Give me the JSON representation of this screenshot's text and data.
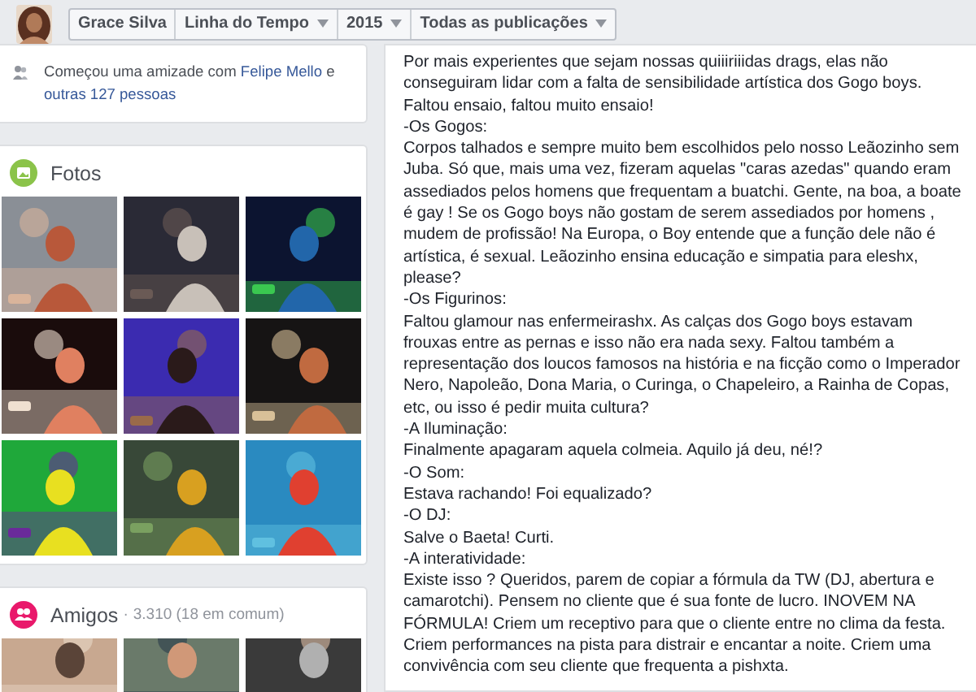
{
  "header": {
    "breadcrumb": [
      {
        "label": "Grace Silva",
        "kind": "link"
      },
      {
        "label": "Linha do Tempo",
        "kind": "dropdown"
      },
      {
        "label": "2015",
        "kind": "dropdown"
      },
      {
        "label": "Todas as publicações",
        "kind": "dropdown"
      }
    ]
  },
  "activity": {
    "prefix": "Começou uma amizade com",
    "link": "Felipe Mello",
    "middle": "e",
    "others": "outras 127 pessoas"
  },
  "photos": {
    "title": "Fotos"
  },
  "friends": {
    "title": "Amigos",
    "separator": "·",
    "count": "3.310 (18 em comum)"
  },
  "post": {
    "paragraphs": [
      "Por mais experientes que sejam nossas quiiiriiidas drags, elas não conseguiram lidar com a falta de sensibilidade artística dos Gogo boys. Faltou ensaio, faltou muito ensaio!",
      "-Os Gogos:",
      "Corpos talhados e sempre muito bem escolhidos pelo nosso Leãozinho sem Juba. Só que, mais uma vez, fizeram aquelas \"caras azedas\" quando eram assediados pelos homens que frequentam a buatchi. Gente, na boa, a boate é gay ! Se os Gogo boys não gostam de serem assediados por homens , mudem de profissão! Na Europa, o Boy entende que a função dele não é artística, é sexual. Leãozinho ensina educação e simpatia para eleshx, please?",
      "-Os Figurinos:",
      "Faltou glamour nas enfermeirashx. As calças dos Gogo boys estavam frouxas entre as pernas e isso não era nada sexy. Faltou também a representação dos loucos famosos na história e na ficção como o Imperador Nero, Napoleão, Dona Maria, o Curinga, o Chapeleiro, a Rainha de Copas, etc, ou isso é pedir muita cultura?",
      "-A Iluminação:",
      "Finalmente apagaram aquela colmeia. Aquilo já deu, né!?",
      "-O Som:",
      "Estava rachando! Foi equalizado?",
      "-O DJ:",
      "Salve o Baeta! Curti.",
      "-A interatividade:",
      "Existe isso ? Queridos, parem de copiar a fórmula da TW (DJ, abertura e camarotchi). Pensem no cliente que é sua fonte de lucro. INOVEM NA FÓRMULA! Criem um receptivo para que o cliente entre no clima da festa. Criem performances na pista para distrair e encantar a noite. Criem uma convivência com seu cliente que frequenta a pishxta."
    ]
  }
}
